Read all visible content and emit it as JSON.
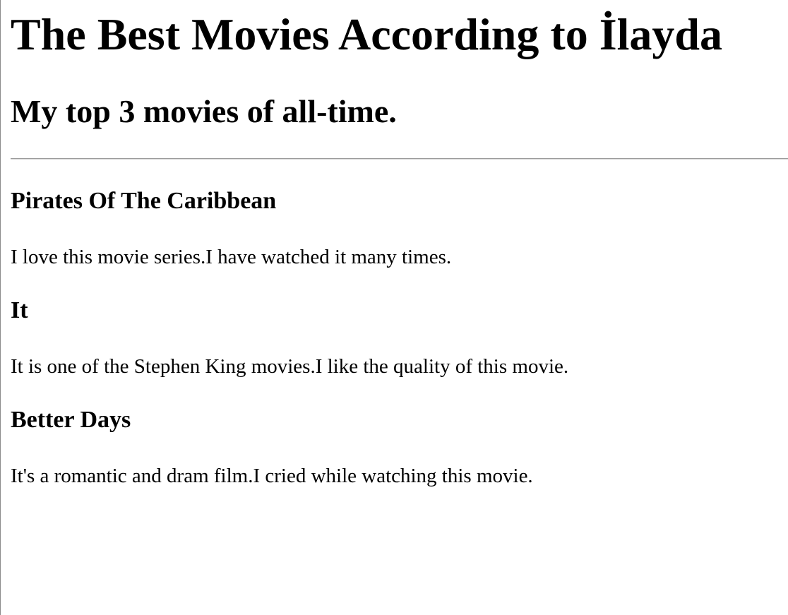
{
  "page": {
    "title": "The Best Movies According to İlayda",
    "subtitle": "My top 3 movies of all-time."
  },
  "movies": [
    {
      "title": "Pirates Of The Caribbean",
      "description": "I love this movie series.I have watched it many times."
    },
    {
      "title": "It",
      "description": "It is one of the Stephen King movies.I like the quality of this movie."
    },
    {
      "title": "Better Days",
      "description": "It's a romantic and dram film.I cried while watching this movie."
    }
  ]
}
